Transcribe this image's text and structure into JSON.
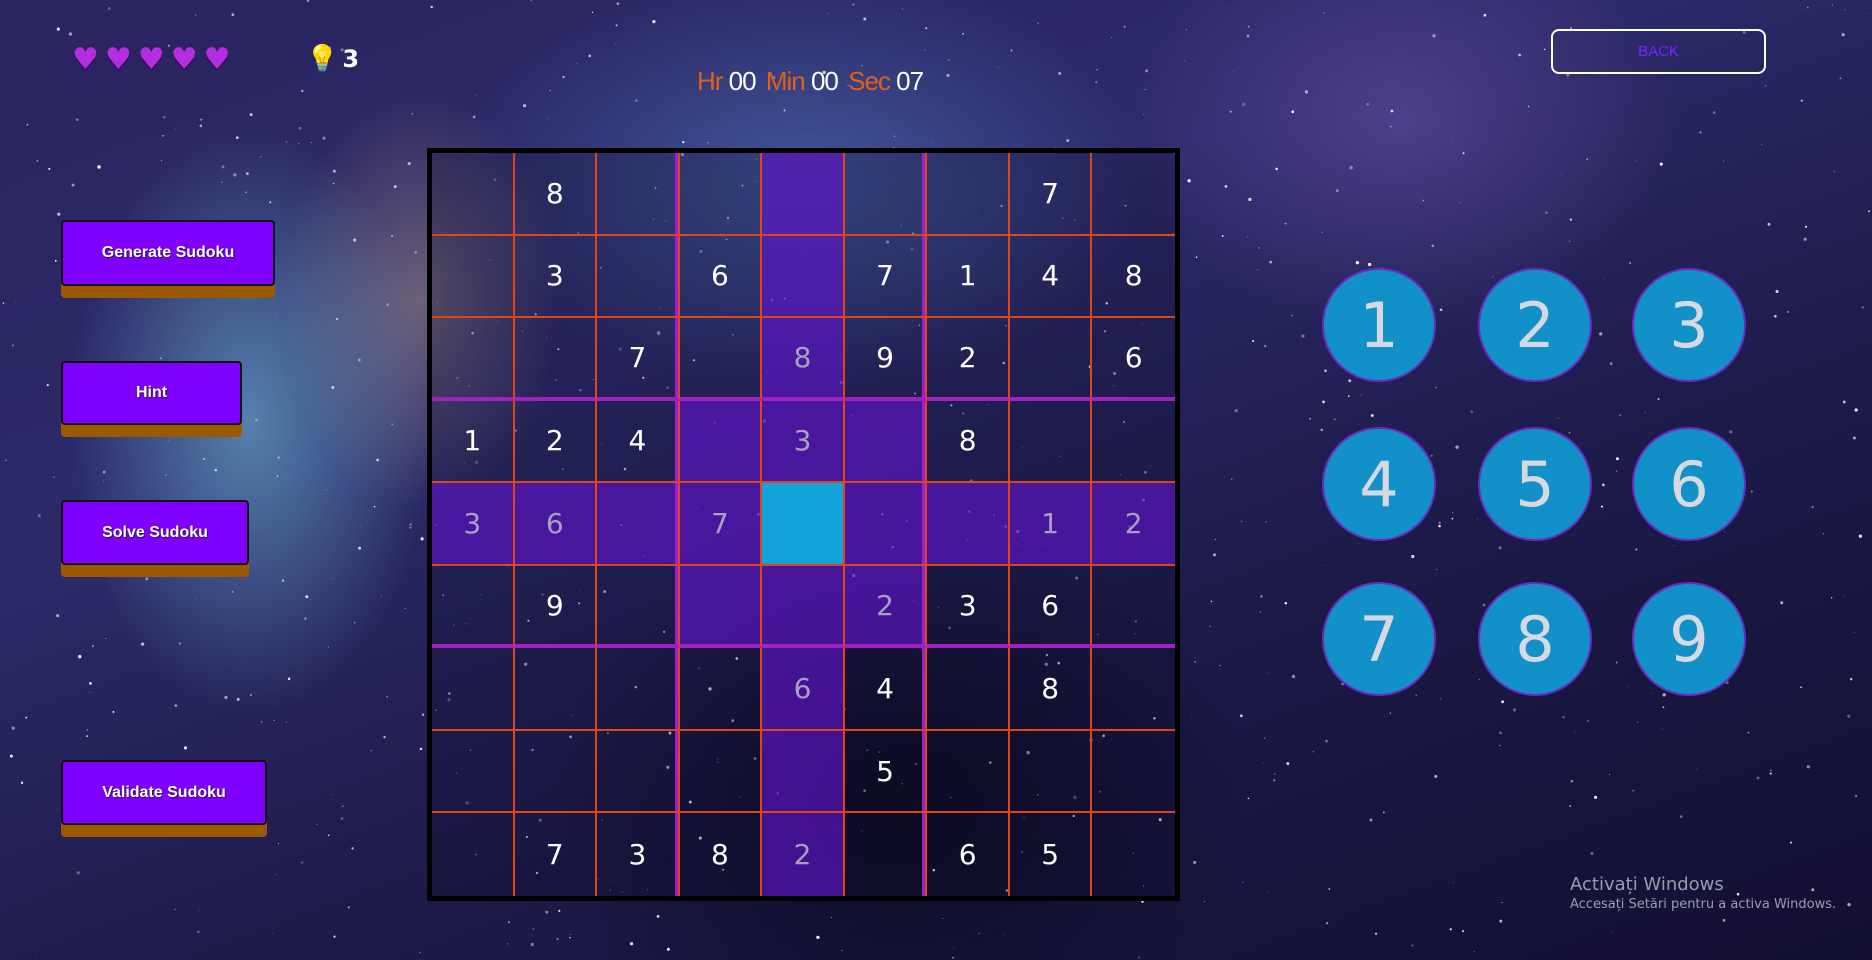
{
  "status": {
    "lives": 5,
    "heart_icon": "heart-icon",
    "hint_icon": "lightbulb-icon",
    "hints_remaining": "3"
  },
  "timer": {
    "hr_label": "Hr",
    "hr": "00",
    "min_label": "Min",
    "min": "00",
    "sec_label": "Sec",
    "sec": "07"
  },
  "back_label": "BACK",
  "buttons": {
    "generate": "Generate Sudoku",
    "hint": "Hint",
    "solve": "Solve Sudoku",
    "validate": "Validate Sudoku"
  },
  "board": {
    "selected": {
      "row": 4,
      "col": 4
    },
    "cells": [
      [
        "",
        "8",
        "",
        "",
        "",
        "",
        "",
        "7",
        ""
      ],
      [
        "",
        "3",
        "",
        "6",
        "",
        "7",
        "1",
        "4",
        "8"
      ],
      [
        "",
        "",
        "7",
        "",
        "8",
        "9",
        "2",
        "",
        "6"
      ],
      [
        "1",
        "2",
        "4",
        "",
        "3",
        "",
        "8",
        "",
        ""
      ],
      [
        "3",
        "6",
        "",
        "7",
        "",
        "",
        "",
        "1",
        "2"
      ],
      [
        "",
        "9",
        "",
        "",
        "",
        "2",
        "3",
        "6",
        ""
      ],
      [
        "",
        "",
        "",
        "",
        "6",
        "4",
        "",
        "8",
        ""
      ],
      [
        "",
        "",
        "",
        "",
        "",
        "5",
        "",
        "",
        ""
      ],
      [
        "",
        "7",
        "3",
        "8",
        "2",
        "",
        "6",
        "5",
        ""
      ]
    ]
  },
  "number_pad": [
    "1",
    "2",
    "3",
    "4",
    "5",
    "6",
    "7",
    "8",
    "9"
  ],
  "colors": {
    "accent": "#7f00ff",
    "cell_border": "#e0451a",
    "selected": "#12a4d8",
    "timer_label": "#e0601a",
    "pad": "#1191c8"
  },
  "watermark": {
    "title": "Activați Windows",
    "subtitle": "Accesați Setări pentru a activa Windows."
  }
}
